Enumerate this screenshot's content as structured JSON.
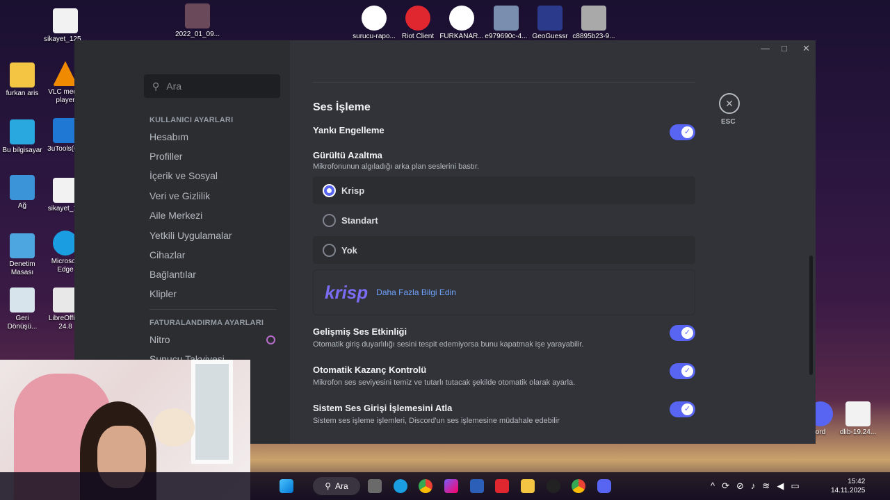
{
  "desktop": {
    "icons": [
      {
        "label": "sikayet_125..."
      },
      {
        "label": "2022_01_09..."
      },
      {
        "label": "surucu-rapo..."
      },
      {
        "label": "Riot Client"
      },
      {
        "label": "FURKANAR..."
      },
      {
        "label": "e979690c-4..."
      },
      {
        "label": "GeoGuessr"
      },
      {
        "label": "c8895b23-9..."
      },
      {
        "label": "furkan aris"
      },
      {
        "label": "VLC media player"
      },
      {
        "label": "Bu bilgisayar"
      },
      {
        "label": "3uTools(6..."
      },
      {
        "label": "Ağ"
      },
      {
        "label": "sikayet_1..."
      },
      {
        "label": "Denetim Masası"
      },
      {
        "label": "Microsoft Edge"
      },
      {
        "label": "Geri Dönüşü..."
      },
      {
        "label": "LibreOffice 24.8"
      },
      {
        "label": "ord"
      },
      {
        "label": "dlib-19.24..."
      }
    ]
  },
  "window": {
    "controls": {
      "minimize": "—",
      "maximize": "□",
      "close": "✕"
    },
    "close_settings": {
      "icon": "✕",
      "label": "ESC"
    }
  },
  "sidebar": {
    "search_placeholder": "Ara",
    "sections": [
      {
        "title": "KULLANICI AYARLARI",
        "items": [
          "Hesabım",
          "Profiller",
          "İçerik ve Sosyal",
          "Veri ve Gizlilik",
          "Aile Merkezi",
          "Yetkili Uygulamalar",
          "Cihazlar",
          "Bağlantılar",
          "Klipler"
        ]
      },
      {
        "title": "FATURALANDIRMA AYARLARI",
        "items": [
          "Nitro",
          "Sunucu Takviyesi"
        ]
      }
    ]
  },
  "content": {
    "heading": "Ses İşleme",
    "echo": {
      "label": "Yankı Engelleme",
      "enabled": true
    },
    "noise": {
      "label": "Gürültü Azaltma",
      "desc": "Mikrofonunun algıladığı arka plan seslerini bastır.",
      "options": [
        {
          "label": "Krisp",
          "selected": true
        },
        {
          "label": "Standart",
          "selected": false
        },
        {
          "label": "Yok",
          "selected": false
        }
      ]
    },
    "krisp": {
      "logo": "krisp",
      "link": "Daha Fazla Bilgi Edin"
    },
    "settings": [
      {
        "label": "Gelişmiş Ses Etkinliği",
        "desc": "Otomatik giriş duyarlılığı sesini tespit edemiyorsa bunu kapatmak işe yarayabilir.",
        "enabled": true
      },
      {
        "label": "Otomatik Kazanç Kontrolü",
        "desc": "Mikrofon ses seviyesini temiz ve tutarlı tutacak şekilde otomatik olarak ayarla.",
        "enabled": true
      },
      {
        "label": "Sistem Ses Girişi İşlemesini Atla",
        "desc": "Sistem ses işleme işlemleri, Discord'un ses işlemesine müdahale edebilir",
        "enabled": true
      }
    ]
  },
  "taskbar": {
    "search_label": "Ara",
    "time": "15:42",
    "date": "14.11.2025"
  },
  "colors": {
    "accent": "#5865f2",
    "link": "#6fa3ff",
    "krisp": "#7b6cf6"
  }
}
